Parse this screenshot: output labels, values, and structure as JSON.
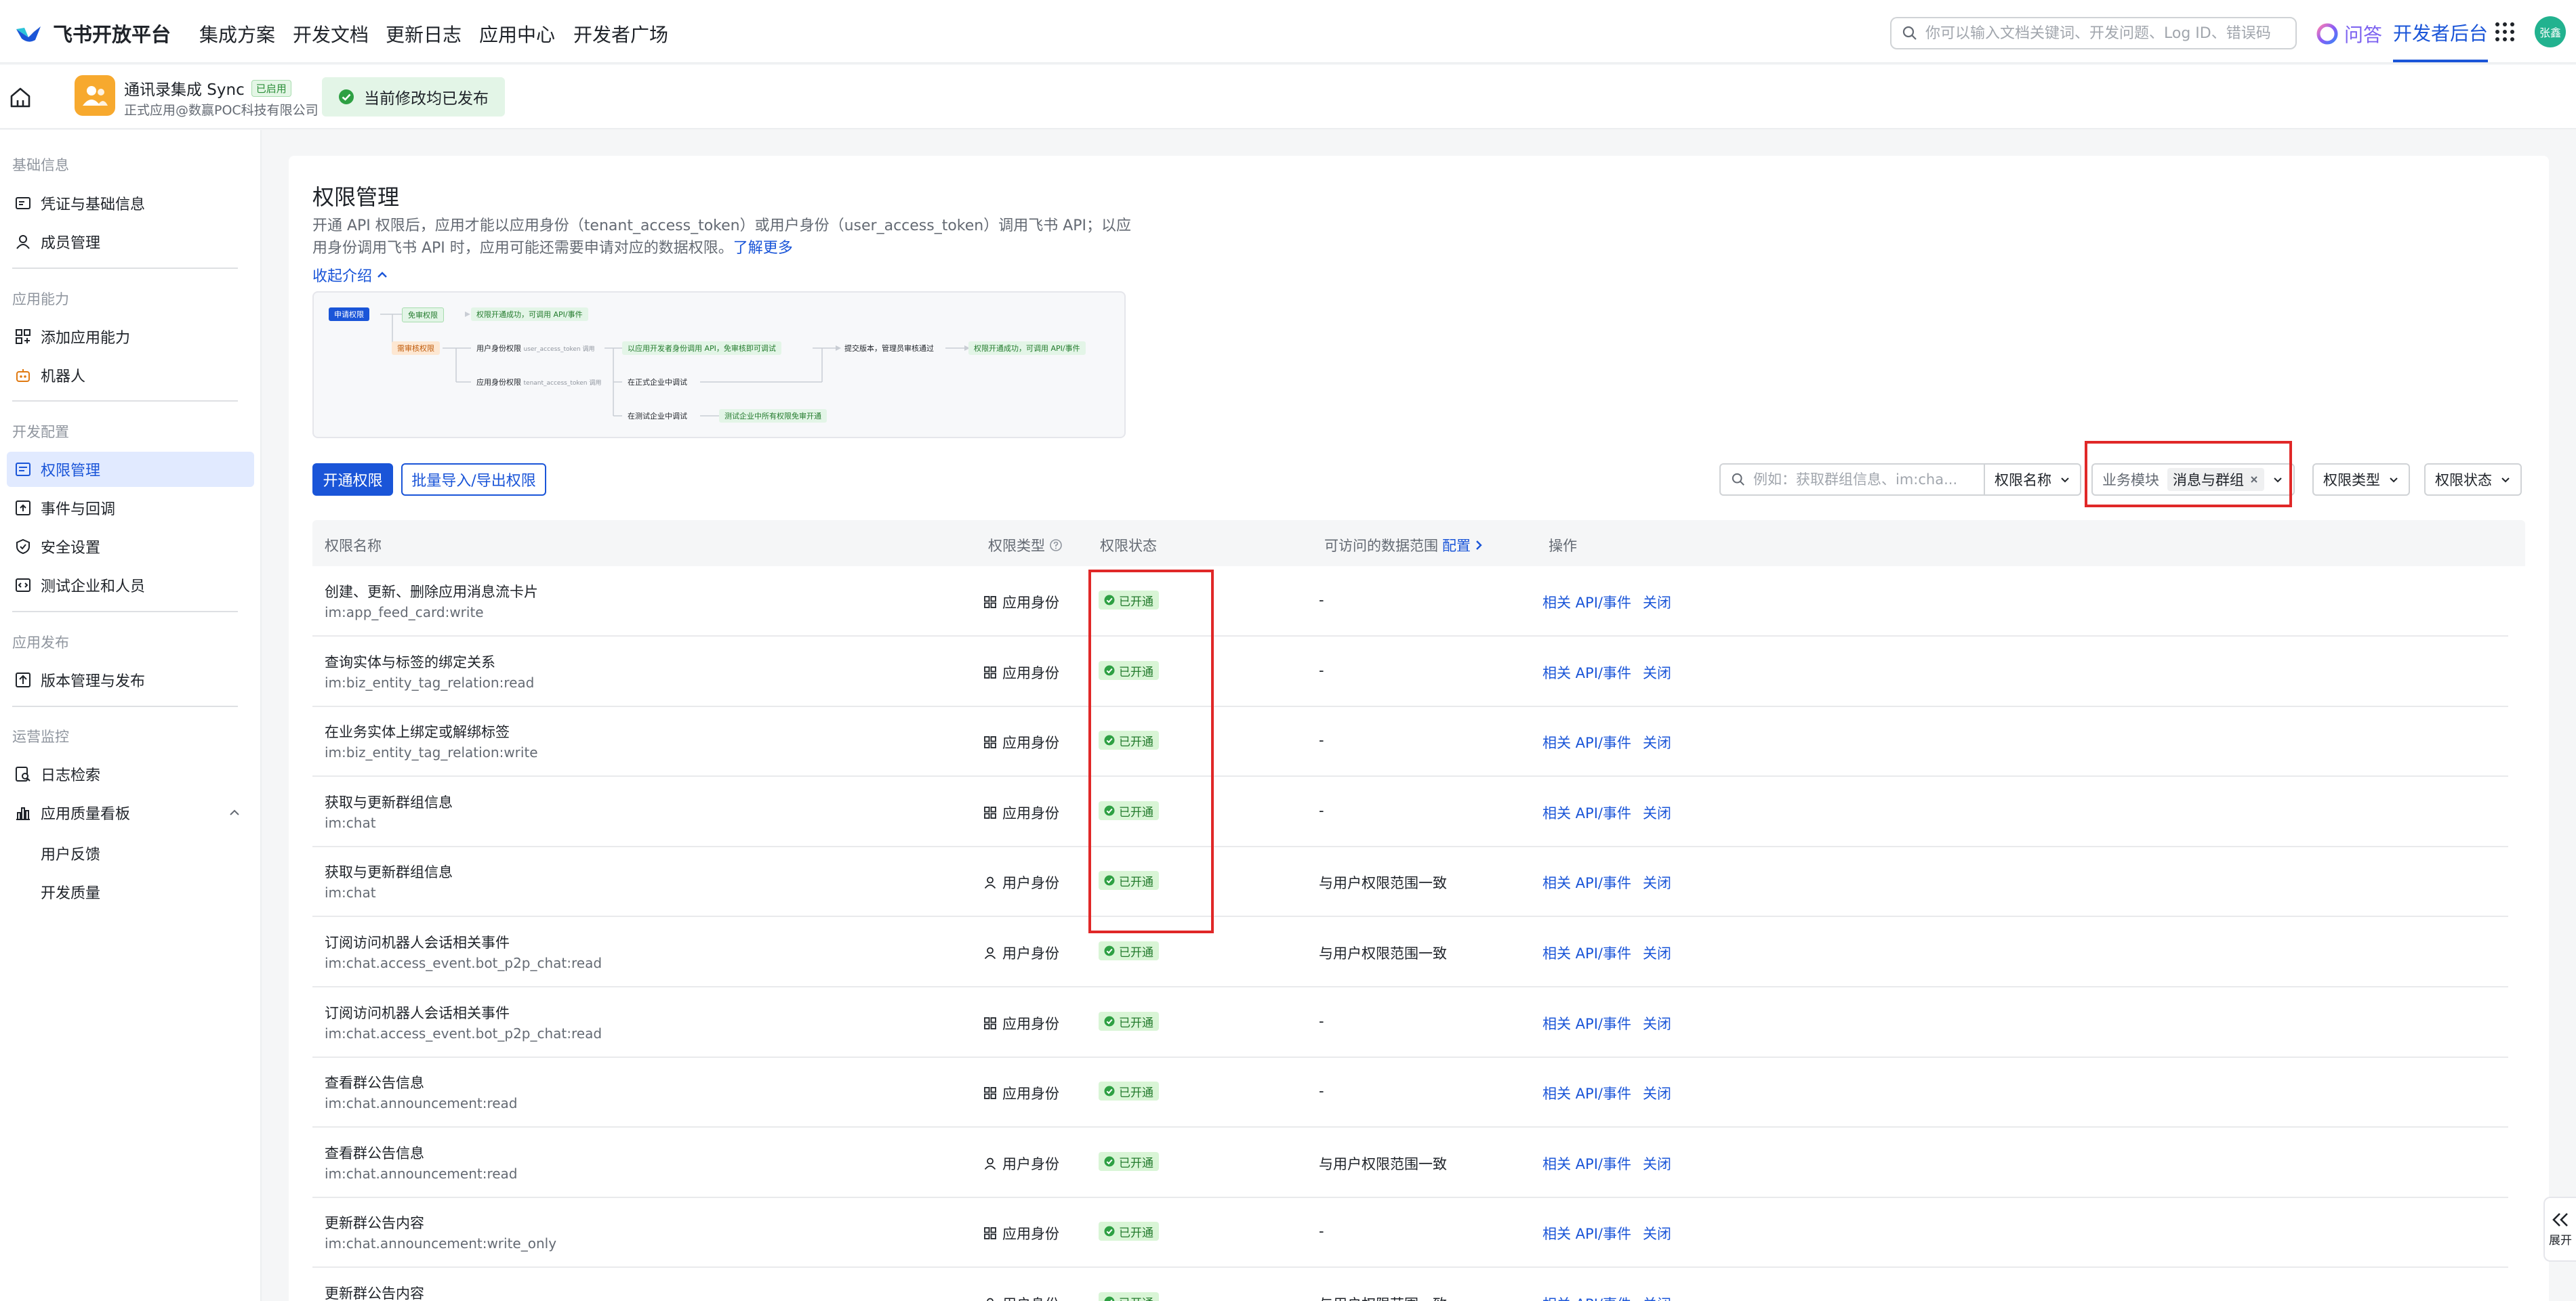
{
  "topnav": {
    "brand": "飞书开放平台",
    "items": [
      "集成方案",
      "开发文档",
      "更新日志",
      "应用中心",
      "开发者广场"
    ],
    "search_placeholder": "你可以输入文档关键词、开发问题、Log ID、错误码",
    "ask": "问答",
    "dev_backend": "开发者后台",
    "avatar_text": "张鑫"
  },
  "app": {
    "name": "通讯录集成 Sync",
    "status_tag": "已启用",
    "subtitle": "正式应用@数赢POC科技有限公司",
    "published_text": "当前修改均已发布"
  },
  "sidebar": {
    "sections": [
      {
        "title": "基础信息",
        "items": [
          "凭证与基础信息",
          "成员管理"
        ]
      },
      {
        "title": "应用能力",
        "items": [
          "添加应用能力",
          "机器人"
        ]
      },
      {
        "title": "开发配置",
        "items": [
          "权限管理",
          "事件与回调",
          "安全设置",
          "测试企业和人员"
        ]
      },
      {
        "title": "应用发布",
        "items": [
          "版本管理与发布"
        ]
      },
      {
        "title": "运营监控",
        "items": [
          "日志检索",
          "应用质量看板"
        ],
        "subitems": [
          "用户反馈",
          "开发质量"
        ]
      }
    ],
    "active": "权限管理"
  },
  "page": {
    "title": "权限管理",
    "desc": "开通 API 权限后，应用才能以应用身份（tenant_access_token）或用户身份（user_access_token）调用飞书 API；以应用身份调用飞书 API 时，应用可能还需要申请对应的数据权限。",
    "learn_more": "了解更多",
    "collapse": "收起介绍"
  },
  "flow": {
    "apply": "申请权限",
    "free": "免审权限",
    "free_result": "权限开通成功，可调用 API/事件",
    "review": "需审核权限",
    "user_perm": "用户身份权限",
    "user_token": "user_access_token 调用",
    "user_result": "以应用开发者身份调用 API，免审核即可调试",
    "submit": "提交版本，管理员审核通过",
    "final_result": "权限开通成功，可调用 API/事件",
    "app_perm": "应用身份权限",
    "tenant_token": "tenant_access_token 调用",
    "prod": "在正式企业中调试",
    "test": "在测试企业中调试",
    "test_result": "测试企业中所有权限免审开通"
  },
  "toolbar": {
    "enable_btn": "开通权限",
    "batch_btn": "批量导入/导出权限",
    "filter_placeholder": "例如：获取群组信息、im:cha...",
    "filter_field": "权限名称",
    "module_label": "业务模块",
    "module_value": "消息与群组",
    "type_filter": "权限类型",
    "status_filter": "权限状态"
  },
  "table": {
    "headers": {
      "name": "权限名称",
      "type": "权限类型",
      "status": "权限状态",
      "scope": "可访问的数据范围",
      "scope_link": "配置",
      "ops": "操作"
    },
    "rows": [
      {
        "name": "创建、更新、删除应用消息流卡片",
        "code": "im:app_feed_card:write",
        "type": "应用身份",
        "status": "已开通",
        "scope": "-",
        "api": "相关 API/事件",
        "close": "关闭"
      },
      {
        "name": "查询实体与标签的绑定关系",
        "code": "im:biz_entity_tag_relation:read",
        "type": "应用身份",
        "status": "已开通",
        "scope": "-",
        "api": "相关 API/事件",
        "close": "关闭"
      },
      {
        "name": "在业务实体上绑定或解绑标签",
        "code": "im:biz_entity_tag_relation:write",
        "type": "应用身份",
        "status": "已开通",
        "scope": "-",
        "api": "相关 API/事件",
        "close": "关闭"
      },
      {
        "name": "获取与更新群组信息",
        "code": "im:chat",
        "type": "应用身份",
        "status": "已开通",
        "scope": "-",
        "api": "相关 API/事件",
        "close": "关闭"
      },
      {
        "name": "获取与更新群组信息",
        "code": "im:chat",
        "type": "用户身份",
        "status": "已开通",
        "scope": "与用户权限范围一致",
        "api": "相关 API/事件",
        "close": "关闭"
      },
      {
        "name": "订阅访问机器人会话相关事件",
        "code": "im:chat.access_event.bot_p2p_chat:read",
        "type": "用户身份",
        "status": "已开通",
        "scope": "与用户权限范围一致",
        "api": "相关 API/事件",
        "close": "关闭"
      },
      {
        "name": "订阅访问机器人会话相关事件",
        "code": "im:chat.access_event.bot_p2p_chat:read",
        "type": "应用身份",
        "status": "已开通",
        "scope": "-",
        "api": "相关 API/事件",
        "close": "关闭"
      },
      {
        "name": "查看群公告信息",
        "code": "im:chat.announcement:read",
        "type": "应用身份",
        "status": "已开通",
        "scope": "-",
        "api": "相关 API/事件",
        "close": "关闭"
      },
      {
        "name": "查看群公告信息",
        "code": "im:chat.announcement:read",
        "type": "用户身份",
        "status": "已开通",
        "scope": "与用户权限范围一致",
        "api": "相关 API/事件",
        "close": "关闭"
      },
      {
        "name": "更新群公告内容",
        "code": "im:chat.announcement:write_only",
        "type": "应用身份",
        "status": "已开通",
        "scope": "-",
        "api": "相关 API/事件",
        "close": "关闭"
      },
      {
        "name": "更新群公告内容",
        "code": "",
        "type": "用户身份",
        "status": "已开通",
        "scope": "与用户权限范围一致",
        "api": "相关 API/事件",
        "close": "关闭"
      }
    ]
  },
  "expand_label": "展开",
  "colors": {
    "accent": "#1a55d8",
    "success_bg": "#d9f5d6",
    "success_text": "#237b2d",
    "highlight": "#e02828",
    "active_bg": "#e1eaff"
  }
}
